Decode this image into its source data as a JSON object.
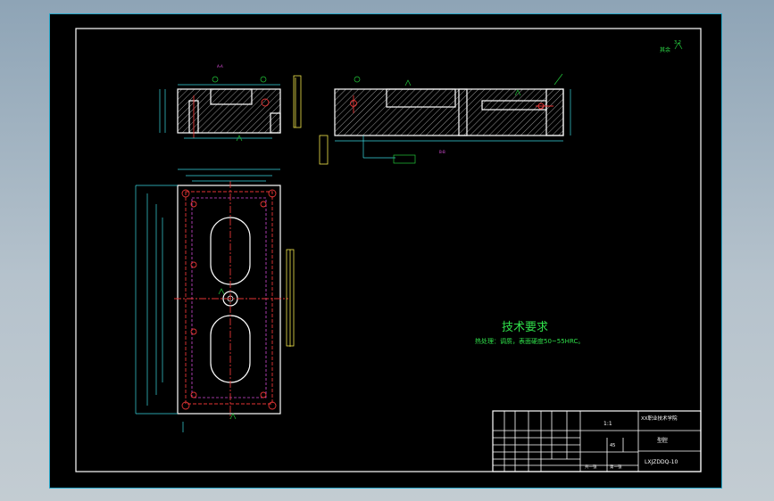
{
  "notes": {
    "title": "技术要求",
    "line1": "热处理：调质，表面硬度50~55HRC。"
  },
  "corner_roughness": "其余",
  "title_block": {
    "scale": "1:1",
    "school": "XX职业技术学院",
    "part_name": "型腔",
    "drawing_no": "LXJZDDQ-10",
    "sheet_total": "共一张",
    "sheet_no": "第一张",
    "material": "45"
  },
  "view_labels": {
    "section_a": "A-A",
    "section_b": "B-B"
  }
}
